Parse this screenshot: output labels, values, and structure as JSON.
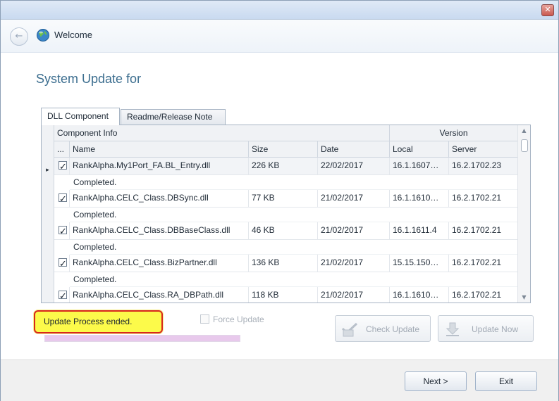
{
  "window": {
    "close_glyph": "✕"
  },
  "nav": {
    "back_glyph": "←",
    "title": "Welcome",
    "icon": "globe-icon"
  },
  "page": {
    "title": "System Update for"
  },
  "tabs": [
    {
      "label": "DLL Component",
      "active": true
    },
    {
      "label": "Readme/Release Note",
      "active": false
    }
  ],
  "grid": {
    "group_headers": {
      "component_info": "Component Info",
      "version": "Version"
    },
    "columns": {
      "select": "...",
      "name": "Name",
      "size": "Size",
      "date": "Date",
      "local": "Local",
      "server": "Server"
    },
    "row_indicator": "▸",
    "rows": [
      {
        "checked": true,
        "name": "RankAlpha.My1Port_FA.BL_Entry.dll",
        "size": "226 KB",
        "date": "22/02/2017",
        "local": "16.1.1607…",
        "server": "16.2.1702.23",
        "status": "Completed."
      },
      {
        "checked": true,
        "name": "RankAlpha.CELC_Class.DBSync.dll",
        "size": "77 KB",
        "date": "21/02/2017",
        "local": "16.1.1610…",
        "server": "16.2.1702.21",
        "status": "Completed."
      },
      {
        "checked": true,
        "name": "RankAlpha.CELC_Class.DBBaseClass.dll",
        "size": "46 KB",
        "date": "21/02/2017",
        "local": "16.1.1611.4",
        "server": "16.2.1702.21",
        "status": "Completed."
      },
      {
        "checked": true,
        "name": "RankAlpha.CELC_Class.BizPartner.dll",
        "size": "136 KB",
        "date": "21/02/2017",
        "local": "15.15.150…",
        "server": "16.2.1702.21",
        "status": "Completed."
      },
      {
        "checked": true,
        "name": "RankAlpha.CELC_Class.RA_DBPath.dll",
        "size": "118 KB",
        "date": "21/02/2017",
        "local": "16.1.1610…",
        "server": "16.2.1702.21",
        "status": ""
      }
    ]
  },
  "status": {
    "message": "Update Process ended.",
    "progress": 1.0
  },
  "force_update": {
    "label": "Force Update",
    "checked": false
  },
  "buttons": {
    "check_update": "Check Update",
    "update_now": "Update Now",
    "next": "Next >",
    "exit": "Exit"
  },
  "colors": {
    "accent_title": "#3c6e8f",
    "status_highlight": "#fcfa4a",
    "status_border": "#d7261e",
    "progress_fill": "#e8c9ec"
  }
}
